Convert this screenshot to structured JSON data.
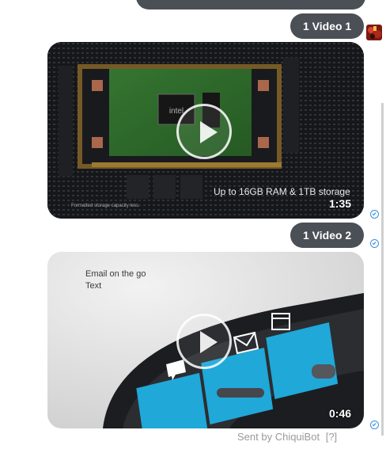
{
  "messages": [
    {
      "label": "1 Video 1"
    },
    {
      "label": "1 Video 2"
    }
  ],
  "videos": [
    {
      "caption": "Up to 16GB RAM & 1TB storage",
      "footnote": "Formatted storage capacity less.",
      "duration": "1:35",
      "chip_brand": "intel"
    },
    {
      "caption_title": "Email on the go",
      "caption_sub": "Text",
      "duration": "0:46"
    }
  ],
  "footer": {
    "sent_by": "Sent by ChiquiBot",
    "help": "[?]"
  },
  "colors": {
    "bubble": "#4b4f56",
    "read_receipt": "#3c8fe0",
    "band_tile": "#1fa8d8"
  }
}
